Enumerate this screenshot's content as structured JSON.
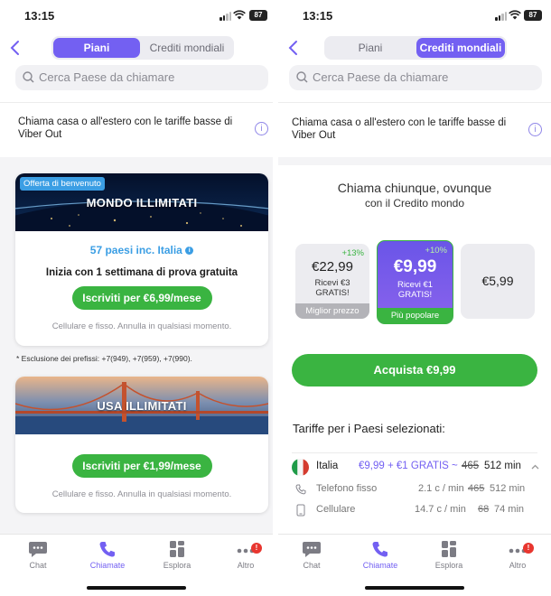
{
  "status": {
    "time": "13:15",
    "battery": "87"
  },
  "left": {
    "seg": {
      "plans": "Piani",
      "credits": "Crediti mondiali"
    },
    "search_placeholder": "Cerca Paese da chiamare",
    "info": "Chiama casa o all'estero con le tariffe basse di Viber Out",
    "card1": {
      "tag": "Offerta di benvenuto",
      "title": "MONDO ILLIMITATI",
      "countries": "57 paesi inc. Italia",
      "trial": "Inizia con 1 settimana di prova gratuita",
      "button": "Iscriviti per €6,99/mese",
      "note": "Cellulare e fisso. Annulla in qualsiasi momento."
    },
    "footnote": "* Esclusione dei prefissi: +7(949), +7(959), +7(990).",
    "card2": {
      "title": "USA ILLIMITATI",
      "button": "Iscriviti per €1,99/mese",
      "note": "Cellulare e fisso. Annulla in qualsiasi momento."
    }
  },
  "right": {
    "seg": {
      "plans": "Piani",
      "credits": "Crediti mondiali"
    },
    "search_placeholder": "Cerca Paese da chiamare",
    "info": "Chiama casa o all'estero con le tariffe basse di Viber Out",
    "headline_1": "Chiama chiunque, ovunque",
    "headline_2": "con il Credito mondo",
    "credits": [
      {
        "pct": "+13%",
        "price": "€22,99",
        "bonus_1": "Ricevi €3",
        "bonus_2": "GRATIS!",
        "label": "Miglior prezzo"
      },
      {
        "pct": "+10%",
        "price": "€9,99",
        "bonus_1": "Ricevi €1",
        "bonus_2": "GRATIS!",
        "label": "Più popolare"
      },
      {
        "price": "€5,99"
      }
    ],
    "buy_button": "Acquista €9,99",
    "rates_title": "Tariffe per i Paesi selezionati:",
    "country": {
      "name": "Italia",
      "offer": "€9,99 + €1 GRATIS ~",
      "old_min": "465",
      "new_min": "512 min"
    },
    "rows": [
      {
        "label": "Telefono fisso",
        "rate": "2.1 c / min",
        "old": "465",
        "new": "512 min"
      },
      {
        "label": "Cellulare",
        "rate": "14.7 c / min",
        "old": "68",
        "new": "74 min"
      }
    ]
  },
  "tabs": [
    {
      "label": "Chat",
      "icon": "chat-icon"
    },
    {
      "label": "Chiamate",
      "icon": "phone-icon",
      "active": true
    },
    {
      "label": "Esplora",
      "icon": "explore-icon"
    },
    {
      "label": "Altro",
      "icon": "more-icon",
      "badge": "!"
    }
  ],
  "colors": {
    "accent": "#7360f2",
    "green": "#3ab441",
    "link_blue": "#3b9ee4",
    "badge_red": "#e8362f"
  }
}
